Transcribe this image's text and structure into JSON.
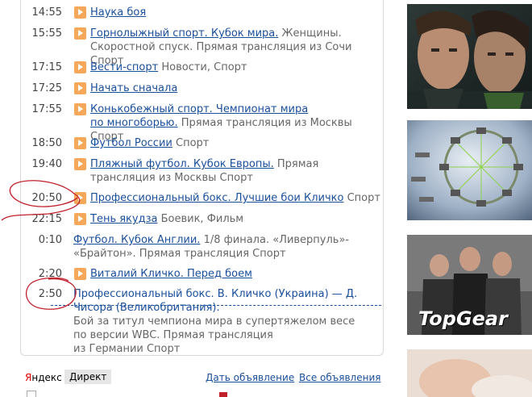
{
  "schedule": [
    {
      "time": "14:55",
      "title": "Наука боя",
      "meta": ""
    },
    {
      "time": "15:55",
      "title": "Горнолыжный спорт. Кубок мира.",
      "meta": " Женщины.",
      "line2": "Скоростной спуск. Прямая трансляция из Сочи Спорт"
    },
    {
      "time": "17:15",
      "title": "Вести-спорт",
      "meta": " Новости, Спорт"
    },
    {
      "time": "17:25",
      "title": "Начать сначала",
      "meta": ""
    },
    {
      "time": "17:55",
      "title": "Конькобежный спорт. Чемпионат мира",
      "line2_link": "по многоборью.",
      "line2": " Прямая трансляция из Москвы Спорт"
    },
    {
      "time": "18:50",
      "title": "Футбол России",
      "meta": " Спорт"
    },
    {
      "time": "19:40",
      "title": "Пляжный футбол. Кубок Европы.",
      "meta": " Прямая",
      "line2": "трансляция из Москвы Спорт"
    },
    {
      "time": "20:50",
      "title": "Профессиональный бокс. Лучшие бои Кличко",
      "meta": " Спорт"
    },
    {
      "time": "22:15",
      "title": "Тень якудза",
      "meta": " Боевик, Фильм"
    },
    {
      "time": "0:10",
      "title": "Футбол. Кубок Англии.",
      "meta": " 1/8 финала. «Ливерпуль»-",
      "line2": "«Брайтон». Прямая трансляция Спорт"
    },
    {
      "time": "2:20",
      "title": "Виталий Кличко. Перед боем",
      "meta": ""
    },
    {
      "time": "2:50",
      "title": "Профессиональный бокс. В. Кличко (Украина) — Д.",
      "line2_link": "Чисора (Великобритания).",
      "line3": " Бой за титул чемпиона мира в супертяжелом весе",
      "line4": "по версии WBC. Прямая трансляция",
      "line5": "из Германии Спорт"
    }
  ],
  "thumbnails": [
    {
      "name": "supernatural-poster"
    },
    {
      "name": "space-station-image"
    },
    {
      "name": "top-gear-image",
      "caption": "TopGear"
    },
    {
      "name": "baby-image"
    }
  ],
  "ad_bar": {
    "yandex_y": "Я",
    "yandex_rest": "ндекс",
    "direkt": "Директ",
    "give_ad": "Дать объявление",
    "all_ads": "Все объявления"
  }
}
